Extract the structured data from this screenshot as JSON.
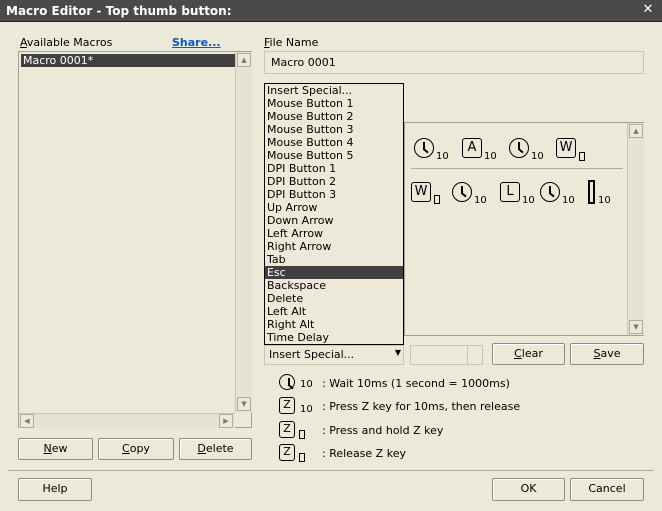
{
  "window": {
    "title": "Macro Editor - Top thumb button:"
  },
  "left": {
    "available_label": "Available Macros",
    "share_label": "Share...",
    "macros": [
      {
        "label": "Macro 0001*"
      }
    ],
    "new_label": "New",
    "copy_label": "Copy",
    "delete_label": "Delete"
  },
  "file": {
    "label": "File Name",
    "value": "Macro 0001"
  },
  "dropdown": {
    "items": [
      "Insert Special...",
      "Mouse Button 1",
      "Mouse Button 2",
      "Mouse Button 3",
      "Mouse Button 4",
      "Mouse Button 5",
      "DPI Button 1",
      "DPI Button 2",
      "DPI Button 3",
      "Up Arrow",
      "Down Arrow",
      "Left Arrow",
      "Right Arrow",
      "Tab",
      "Esc",
      "Backspace",
      "Delete",
      "Left Alt",
      "Right Alt",
      "Time Delay"
    ],
    "selected": "Esc",
    "combo_value": "Insert Special..."
  },
  "sequence": {
    "row1": [
      {
        "type": "clock",
        "sub": "10"
      },
      {
        "type": "key",
        "key": "A",
        "sub": "10"
      },
      {
        "type": "clock",
        "sub": "10"
      },
      {
        "type": "key",
        "key": "W",
        "sub": "hold"
      }
    ],
    "row2": [
      {
        "type": "key",
        "key": "W",
        "sub": "release"
      },
      {
        "type": "clock",
        "sub": "10"
      },
      {
        "type": "key",
        "key": "L",
        "sub": "10"
      },
      {
        "type": "clock",
        "sub": "10"
      },
      {
        "type": "cursor",
        "sub": "10"
      }
    ]
  },
  "actions": {
    "clear_label": "Clear",
    "save_label": "Save"
  },
  "legend": {
    "wait": {
      "num": "10",
      "text": ": Wait 10ms (1 second = 1000ms)"
    },
    "press": {
      "key": "Z",
      "num": "10",
      "text": ": Press Z key for 10ms, then release"
    },
    "hold": {
      "key": "Z",
      "text": ": Press and hold Z key"
    },
    "release": {
      "key": "Z",
      "text": ": Release Z key"
    }
  },
  "footer": {
    "help_label": "Help",
    "ok_label": "OK",
    "cancel_label": "Cancel"
  }
}
